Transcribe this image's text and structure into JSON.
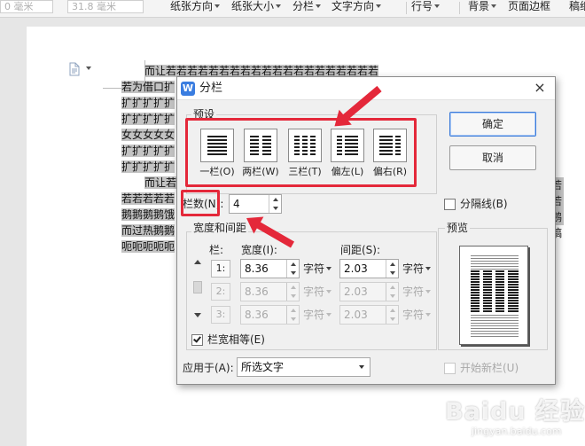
{
  "toolbar": {
    "indent_left_value": "0 毫米",
    "indent_right_value": "31.8 毫米",
    "orientation": "纸张方向",
    "paper_size": "纸张大小",
    "columns": "分栏",
    "text_direction": "文字方向",
    "line_numbers": "行号",
    "background": "背景",
    "page_border": "页面边框",
    "draft": "稿纸"
  },
  "document": {
    "lines": [
      "而让若若若若若若若若若若若若若若若若若若若若",
      "若为借口扩",
      "扩扩扩扩扩",
      "扩扩扩扩扩",
      "女女女女女",
      "扩扩扩扩扩",
      "扩扩扩扩扩",
      "而让若若若",
      "若若若若若",
      "鹅鹅鹅鹅饿",
      "而过热鹅鹅",
      "呃呃呃呃呃"
    ],
    "right_fragments": [
      "若",
      "若",
      "鹅",
      "稿"
    ]
  },
  "dialog": {
    "title": "分栏",
    "close": "×",
    "presets_label": "预设",
    "presets": [
      {
        "label": "一栏(O)"
      },
      {
        "label": "两栏(W)"
      },
      {
        "label": "三栏(T)"
      },
      {
        "label": "偏左(L)"
      },
      {
        "label": "偏右(R)"
      }
    ],
    "ok": "确定",
    "cancel": "取消",
    "column_count_label": "栏数(N):",
    "column_count_value": "4",
    "separator_label": "分隔线(B)",
    "separator_checked": false,
    "width_spacing_label": "宽度和间距",
    "col_header": "栏:",
    "width_header": "宽度(I):",
    "spacing_header": "间距(S):",
    "rows": [
      {
        "num": "1:",
        "width": "8.36",
        "spacing": "2.03",
        "enabled": true
      },
      {
        "num": "2:",
        "width": "8.36",
        "spacing": "2.03",
        "enabled": false
      },
      {
        "num": "3:",
        "width": "8.36",
        "spacing": "2.03",
        "enabled": false
      }
    ],
    "unit": "字符",
    "equal_width_label": "栏宽相等(E)",
    "equal_width_checked": true,
    "preview_label": "预览",
    "apply_to_label": "应用于(A):",
    "apply_to_value": "所选文字",
    "new_column_label": "开始新栏(U)",
    "new_column_checked": false
  },
  "watermark": {
    "text": "Baidu 经验",
    "url": "jingyan.baidu.com"
  },
  "colors": {
    "annotation": "#e4283a",
    "accent": "#3b7bd9"
  }
}
